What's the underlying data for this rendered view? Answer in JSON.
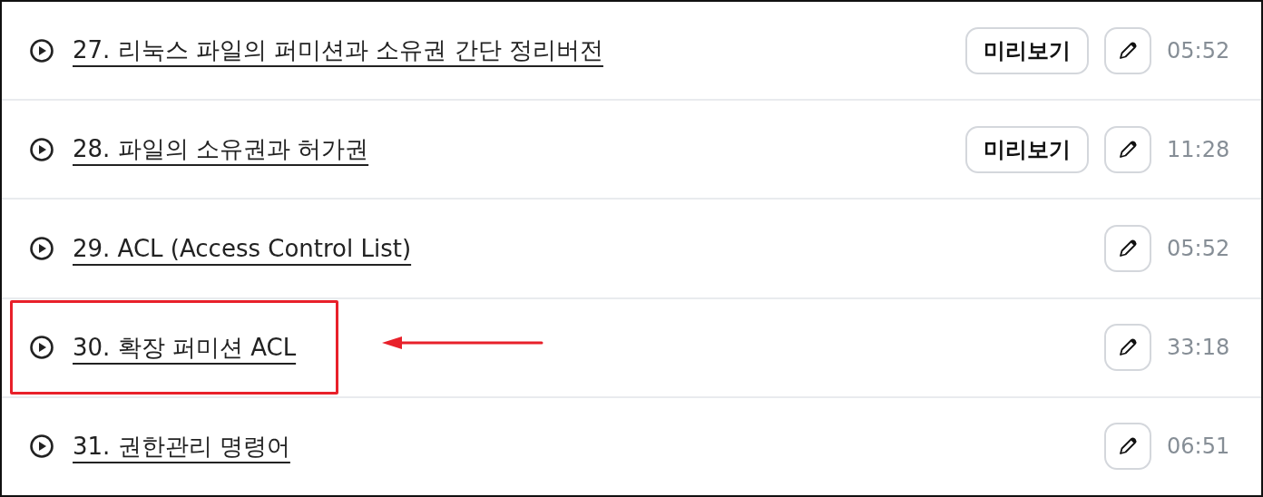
{
  "lessons": [
    {
      "title": "27. 리눅스 파일의 퍼미션과 소유권 간단 정리버전",
      "preview": "미리보기",
      "duration": "05:52",
      "highlighted": false
    },
    {
      "title": "28. 파일의 소유권과 허가권",
      "preview": "미리보기",
      "duration": "11:28",
      "highlighted": false
    },
    {
      "title": "29. ACL (Access Control List)",
      "duration": "05:52",
      "highlighted": false
    },
    {
      "title": "30. 확장 퍼미션 ACL",
      "duration": "33:18",
      "highlighted": true
    },
    {
      "title": "31. 권한관리 명령어",
      "duration": "06:51",
      "highlighted": false
    }
  ]
}
